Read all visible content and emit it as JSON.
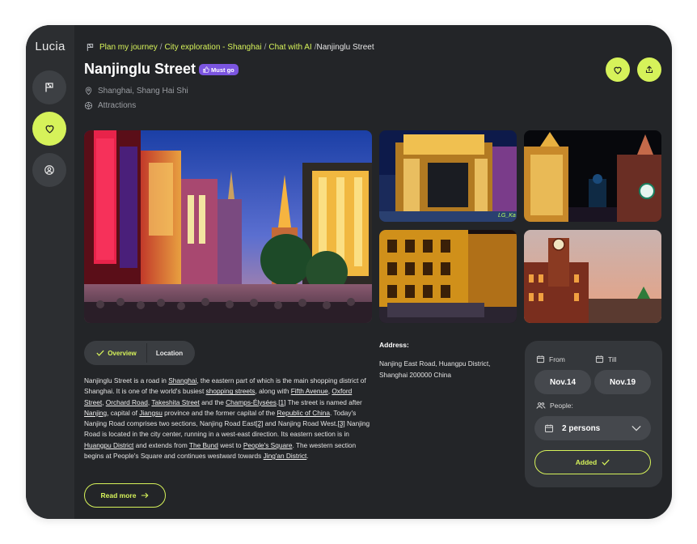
{
  "app": {
    "logo": "Lucia"
  },
  "breadcrumb": {
    "items": [
      "Plan my journey",
      "City exploration - Shanghai",
      "Chat with AI"
    ],
    "separators": [
      "/",
      "/",
      "/"
    ],
    "current": "Nanjinglu Street"
  },
  "place": {
    "title": "Nanjinglu Street",
    "badge": "Must go",
    "location": "Shanghai, Shang Hai Shi",
    "category": "Attractions"
  },
  "tabs": {
    "overview": "Overview",
    "location": "Location",
    "active": "Overview"
  },
  "description": [
    {
      "t": "Nanjinglu Street is a road in "
    },
    {
      "t": "Shanghai",
      "u": true
    },
    {
      "t": ", the eastern part of which is the main shopping district of Shanghai. It is one of the world's busiest "
    },
    {
      "t": "shopping streets",
      "u": true
    },
    {
      "t": ", along with "
    },
    {
      "t": "Fifth Avenue",
      "u": true
    },
    {
      "t": ", "
    },
    {
      "t": "Oxford Street",
      "u": true
    },
    {
      "t": ", "
    },
    {
      "t": "Orchard Road",
      "u": true
    },
    {
      "t": ", "
    },
    {
      "t": "Takeshita Street",
      "u": true
    },
    {
      "t": " and the "
    },
    {
      "t": "Champs-Élysées",
      "u": true
    },
    {
      "t": "."
    },
    {
      "t": "[1]",
      "u": true
    },
    {
      "t": " The street is named after "
    },
    {
      "t": "Nanjing",
      "u": true
    },
    {
      "t": ", capital of "
    },
    {
      "t": "Jiangsu",
      "u": true
    },
    {
      "t": " province and the former capital of the "
    },
    {
      "t": "Republic of China",
      "u": true
    },
    {
      "t": ". Today's Nanjing Road comprises two sections, Nanjing Road East"
    },
    {
      "t": "[2]",
      "u": true
    },
    {
      "t": " and Nanjing Road West."
    },
    {
      "t": "[3]",
      "u": true
    },
    {
      "t": " Nanjing Road is located in the city center, running in a west-east direction. Its eastern section is in "
    },
    {
      "t": "Huangpu District",
      "u": true
    },
    {
      "t": " and extends from "
    },
    {
      "t": "The Bund",
      "u": true
    },
    {
      "t": " west to "
    },
    {
      "t": "People's Square",
      "u": true
    },
    {
      "t": ". The western section begins at People's Square and continues westward towards "
    },
    {
      "t": "Jing'an District",
      "u": true
    },
    {
      "t": "."
    }
  ],
  "read_more": "Read more",
  "address": {
    "label": "Address:",
    "line1": "Nanjing East Road, Huangpu District,",
    "line2": "Shanghai 200000 China"
  },
  "booking": {
    "from_label": "From",
    "till_label": "Till",
    "from_value": "Nov.14",
    "till_value": "Nov.19",
    "people_label": "People:",
    "people_value": "2 persons",
    "added_label": "Added"
  },
  "photo_watermark": "LG_Ka",
  "colors": {
    "accent": "#d6f25a",
    "badge": "#7b55e0",
    "panel": "#232528"
  },
  "icons": [
    "flag-icon",
    "heart-icon",
    "user-icon",
    "share-icon",
    "pin-icon",
    "attractions-icon",
    "calendar-icon",
    "people-icon",
    "chevron-down-icon",
    "check-icon",
    "arrow-right-icon",
    "thumbs-up-icon"
  ]
}
